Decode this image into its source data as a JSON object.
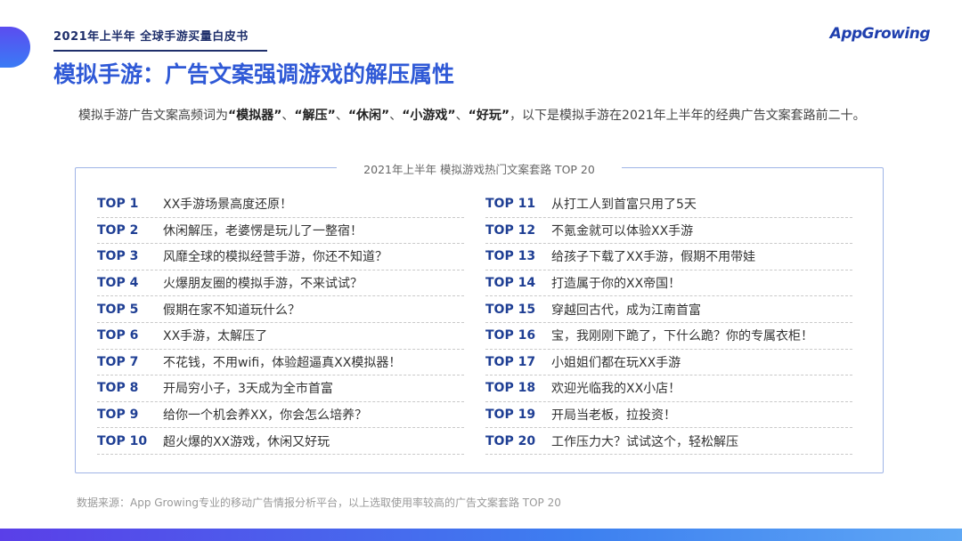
{
  "header": {
    "label": "2021年上半年 全球手游买量白皮书",
    "logo": "AppGrowing"
  },
  "title": "模拟手游：广告文案强调游戏的解压属性",
  "intro": {
    "prefix": "模拟手游广告文案高频词为",
    "kw1": "“模拟器”",
    "sep1": "、",
    "kw2": "“解压”",
    "sep2": "、",
    "kw3": "“休闲”",
    "sep3": "、",
    "kw4": "“小游戏”",
    "sep4": "、",
    "kw5": "“好玩”",
    "suffix": "，以下是模拟手游在2021年上半年的经典广告文案套路前二十。"
  },
  "panel": {
    "title": "2021年上半年 模拟游戏热门文案套路 TOP 20",
    "left": [
      {
        "rank": "TOP 1",
        "text": "XX手游场景高度还原！"
      },
      {
        "rank": "TOP 2",
        "text": "休闲解压，老婆愣是玩儿了一整宿！"
      },
      {
        "rank": "TOP 3",
        "text": "风靡全球的模拟经营手游，你还不知道？"
      },
      {
        "rank": "TOP 4",
        "text": "火爆朋友圈的模拟手游，不来试试？"
      },
      {
        "rank": "TOP 5",
        "text": "假期在家不知道玩什么？"
      },
      {
        "rank": "TOP 6",
        "text": "XX手游，太解压了"
      },
      {
        "rank": "TOP 7",
        "text": "不花钱，不用wifi，体验超逼真XX模拟器！"
      },
      {
        "rank": "TOP 8",
        "text": "开局穷小子，3天成为全市首富"
      },
      {
        "rank": "TOP 9",
        "text": "给你一个机会养XX，你会怎么培养？"
      },
      {
        "rank": "TOP 10",
        "text": "超火爆的XX游戏，休闲又好玩"
      }
    ],
    "right": [
      {
        "rank": "TOP 11",
        "text": "从打工人到首富只用了5天"
      },
      {
        "rank": "TOP 12",
        "text": "不氪金就可以体验XX手游"
      },
      {
        "rank": "TOP 13",
        "text": "给孩子下载了XX手游，假期不用带娃"
      },
      {
        "rank": "TOP 14",
        "text": "打造属于你的XX帝国！"
      },
      {
        "rank": "TOP 15",
        "text": "穿越回古代，成为江南首富"
      },
      {
        "rank": "TOP 16",
        "text": "宝，我刚刚下跪了，下什么跪？你的专属衣柜！"
      },
      {
        "rank": "TOP 17",
        "text": "小姐姐们都在玩XX手游"
      },
      {
        "rank": "TOP 18",
        "text": "欢迎光临我的XX小店！"
      },
      {
        "rank": "TOP 19",
        "text": "开局当老板，拉投资！"
      },
      {
        "rank": "TOP 20",
        "text": "工作压力大？试试这个，轻松解压"
      }
    ]
  },
  "source": "数据来源：App Growing专业的移动广告情报分析平台，以上选取使用率较高的广告文案套路 TOP 20",
  "colors": {
    "accent": "#2f59d6",
    "rank": "#1f3f94",
    "bar_start": "#5a3fe8",
    "bar_end": "#5fa8f5"
  }
}
